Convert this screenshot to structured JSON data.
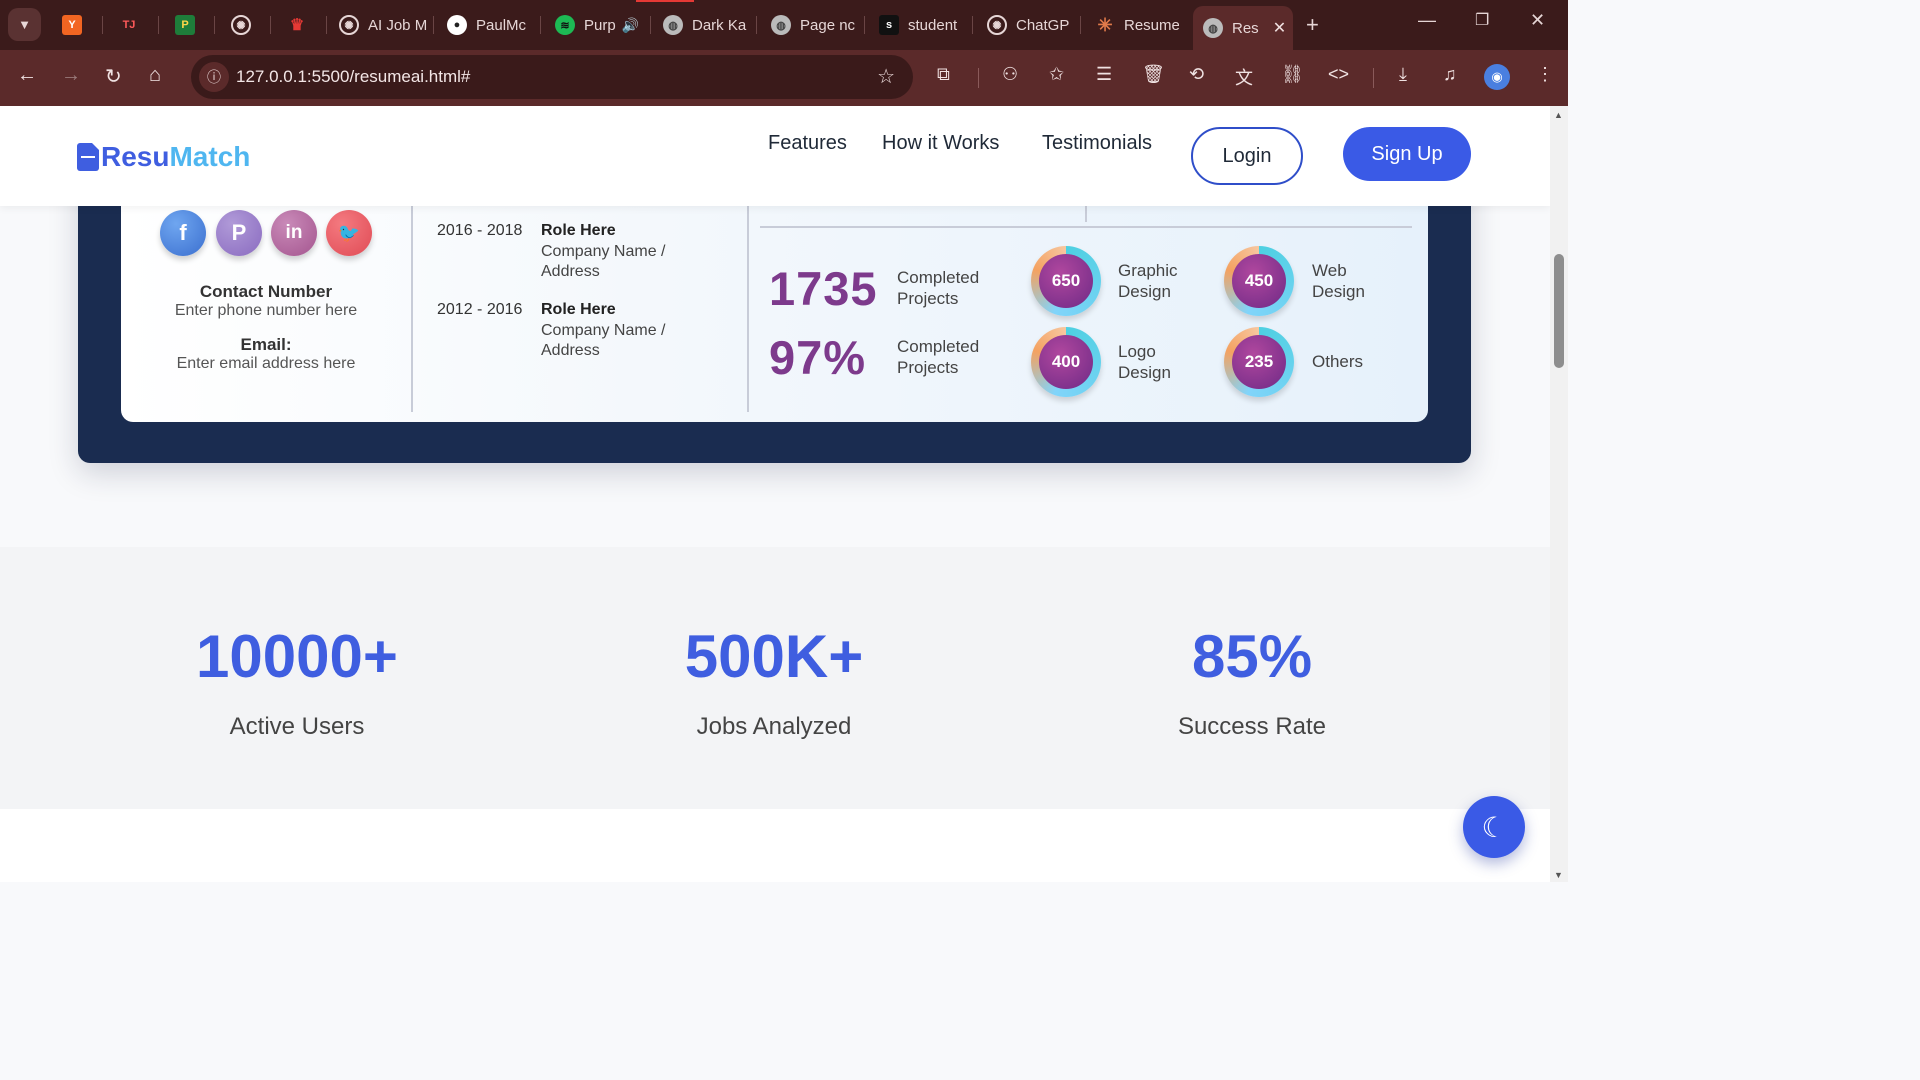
{
  "browser": {
    "tabs": [
      {
        "title": "",
        "icon": "y-combinator-icon"
      },
      {
        "title": "",
        "icon": "tj-icon"
      },
      {
        "title": "",
        "icon": "p-icon"
      },
      {
        "title": "",
        "icon": "openai-icon"
      },
      {
        "title": "",
        "icon": "crown-icon"
      },
      {
        "title": "AI Job M",
        "icon": "openai-icon"
      },
      {
        "title": "PaulMc",
        "icon": "github-icon"
      },
      {
        "title": "Purp",
        "icon": "spotify-icon"
      },
      {
        "title": "Dark Ka",
        "icon": "globe-icon"
      },
      {
        "title": "Page nc",
        "icon": "globe-icon"
      },
      {
        "title": "student",
        "icon": "student-icon"
      },
      {
        "title": "ChatGP",
        "icon": "openai-icon"
      },
      {
        "title": "Resume",
        "icon": "claude-icon"
      },
      {
        "title": "Res",
        "icon": "globe-icon",
        "active": true
      }
    ],
    "url": "127.0.0.1:5500/resumeai.html#"
  },
  "site": {
    "logo_a": "Resu",
    "logo_b": "Match",
    "nav": [
      "Features",
      "How it Works",
      "Testimonials"
    ],
    "login": "Login",
    "signup": "Sign Up"
  },
  "resume_preview": {
    "contact_label": "Contact Number",
    "contact_value": "Enter phone number here",
    "email_label": "Email:",
    "email_value": "Enter email address here",
    "experience": [
      {
        "dates": "2016 - 2018",
        "role": "Role Here",
        "company": "Company Name / Address"
      },
      {
        "dates": "2012 - 2016",
        "role": "Role Here",
        "company": "Company Name / Address"
      }
    ],
    "big_stats": [
      {
        "value": "1735",
        "label": "Completed Projects"
      },
      {
        "value": "97%",
        "label": "Completed Projects"
      }
    ],
    "rings": [
      {
        "value": "650",
        "label": "Graphic Design"
      },
      {
        "value": "450",
        "label": "Web Design"
      },
      {
        "value": "400",
        "label": "Logo Design"
      },
      {
        "value": "235",
        "label": "Others"
      }
    ]
  },
  "stats": [
    {
      "value": "10000+",
      "label": "Active Users"
    },
    {
      "value": "500K+",
      "label": "Jobs Analyzed"
    },
    {
      "value": "85%",
      "label": "Success Rate"
    }
  ],
  "colors": {
    "accent": "#3f5ee0",
    "accent_light": "#4fb6f0",
    "hero_bg": "#1a2c50",
    "chrome": "#5b2a2a"
  }
}
